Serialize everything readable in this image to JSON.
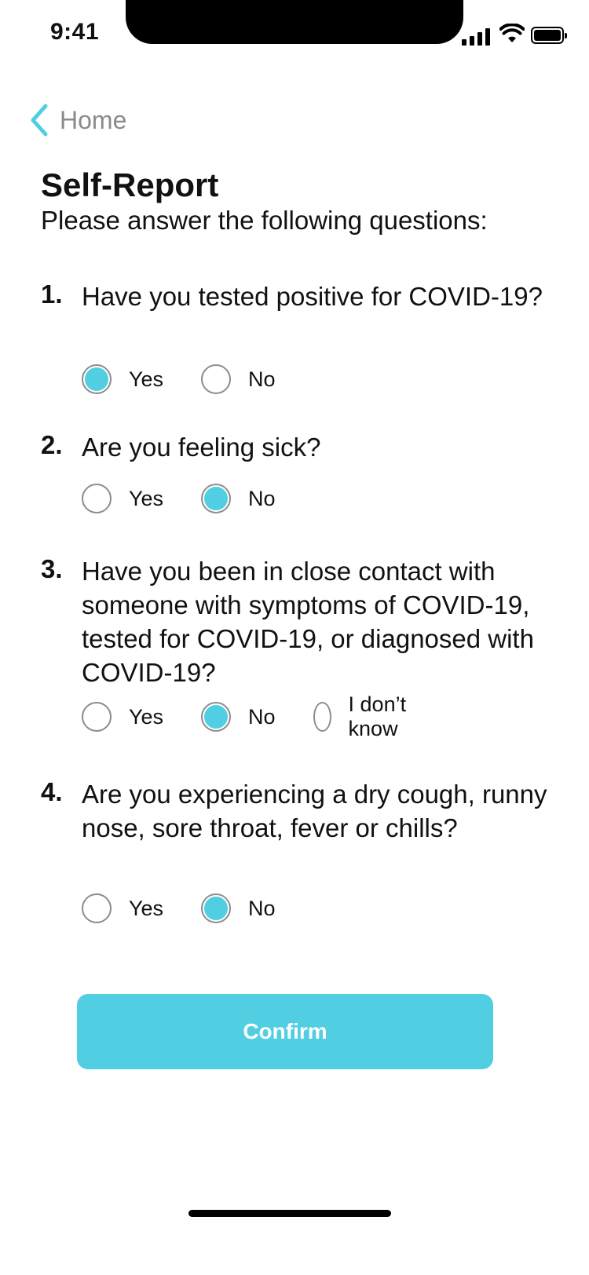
{
  "status_bar": {
    "time": "9:41"
  },
  "nav": {
    "back_label": "Home"
  },
  "header": {
    "title": "Self-Report",
    "subtitle": "Please answer the following questions:"
  },
  "questions": [
    {
      "number": "1.",
      "text": "Have you tested positive for COVID-19?",
      "options": [
        "Yes",
        "No"
      ],
      "selected": "Yes"
    },
    {
      "number": "2.",
      "text": "Are you feeling sick?",
      "options": [
        "Yes",
        "No"
      ],
      "selected": "No"
    },
    {
      "number": "3.",
      "text": "Have you been in close contact with someone with symptoms of COVID-19, tested for COVID-19, or diagnosed with COVID-19?",
      "options": [
        "Yes",
        "No",
        "I don’t know"
      ],
      "selected": "No"
    },
    {
      "number": "4.",
      "text": "Are you experiencing a dry cough, runny nose, sore throat, fever or chills?",
      "options": [
        "Yes",
        "No"
      ],
      "selected": "No"
    }
  ],
  "confirm_button": {
    "label": "Confirm"
  },
  "colors": {
    "accent": "#52cee3",
    "back_link_text": "#8a8a8a",
    "radio_border": "#8c8c8c"
  },
  "icons": {
    "back": "chevron-left-icon",
    "signal": "cellular-signal-icon",
    "wifi": "wifi-icon",
    "battery": "battery-icon"
  }
}
